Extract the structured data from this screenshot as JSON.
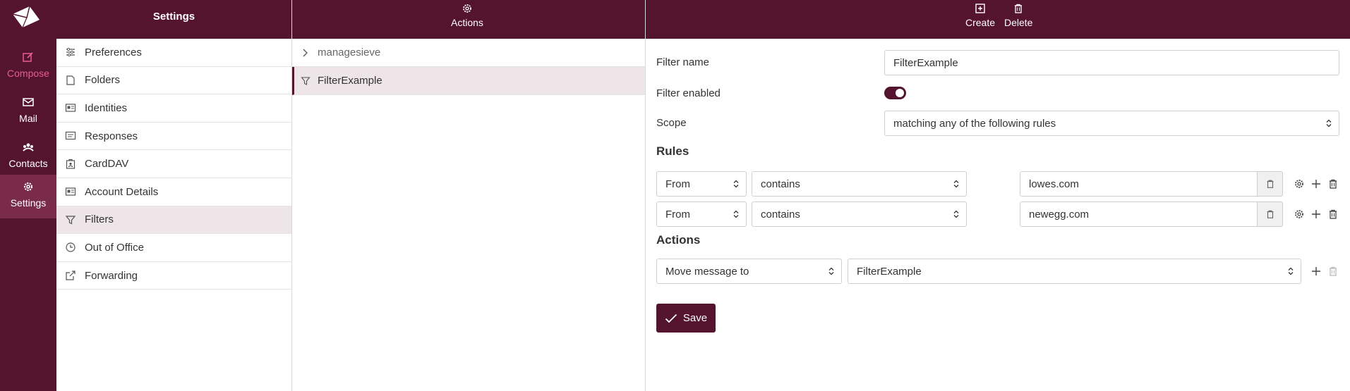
{
  "rail": {
    "items": [
      {
        "label": "Compose",
        "icon": "compose-icon"
      },
      {
        "label": "Mail",
        "icon": "mail-icon"
      },
      {
        "label": "Contacts",
        "icon": "contacts-icon"
      },
      {
        "label": "Settings",
        "icon": "gear-icon"
      }
    ],
    "accent_color": "#e95a96",
    "brand_color": "#54142e"
  },
  "settings_panel": {
    "title": "Settings",
    "items": [
      {
        "label": "Preferences",
        "icon": "sliders-icon"
      },
      {
        "label": "Folders",
        "icon": "folder-icon"
      },
      {
        "label": "Identities",
        "icon": "id-card-icon"
      },
      {
        "label": "Responses",
        "icon": "responses-icon"
      },
      {
        "label": "CardDAV",
        "icon": "contact-book-icon"
      },
      {
        "label": "Account Details",
        "icon": "account-card-icon"
      },
      {
        "label": "Filters",
        "icon": "filter-icon"
      },
      {
        "label": "Out of Office",
        "icon": "clock-icon"
      },
      {
        "label": "Forwarding",
        "icon": "forward-icon"
      }
    ],
    "active": "Filters"
  },
  "list_panel": {
    "header_label": "Actions",
    "group_label": "managesieve",
    "filter_label": "FilterExample"
  },
  "detail_panel": {
    "create_label": "Create",
    "delete_label": "Delete",
    "filter_name_label": "Filter name",
    "filter_name_value": "FilterExample",
    "filter_enabled_label": "Filter enabled",
    "filter_enabled": true,
    "scope_label": "Scope",
    "scope_value": "matching any of the following rules",
    "rules_heading": "Rules",
    "rules": [
      {
        "field": "From",
        "operator": "contains",
        "value": "lowes.com"
      },
      {
        "field": "From",
        "operator": "contains",
        "value": "newegg.com"
      }
    ],
    "actions_heading": "Actions",
    "action": {
      "type": "Move message to",
      "target": "FilterExample"
    },
    "save_label": "Save"
  }
}
